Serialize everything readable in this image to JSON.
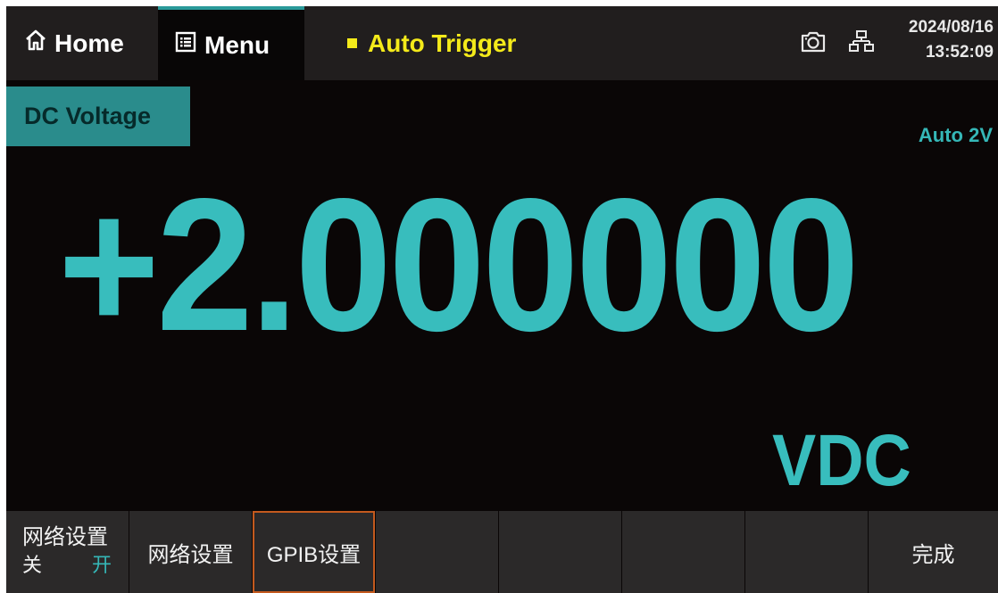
{
  "header": {
    "home_label": "Home",
    "menu_label": "Menu",
    "trigger_label": "Auto Trigger",
    "date": "2024/08/16",
    "time": "13:52:09",
    "icons": [
      "home-icon",
      "menu-icon",
      "camera-icon",
      "network-icon"
    ]
  },
  "measurement": {
    "function": "DC Voltage",
    "range": "Auto 2V",
    "value": "+2.000000",
    "unit": "VDC"
  },
  "softkeys": {
    "network_toggle": {
      "title": "网络设置",
      "off": "关",
      "on": "开"
    },
    "network_settings": "网络设置",
    "gpib_settings": "GPIB设置",
    "done": "完成"
  },
  "colors": {
    "accent": "#38bdbd",
    "trigger": "#f4ea1a",
    "active_border": "#c45a1e",
    "background": "#0a0606"
  }
}
